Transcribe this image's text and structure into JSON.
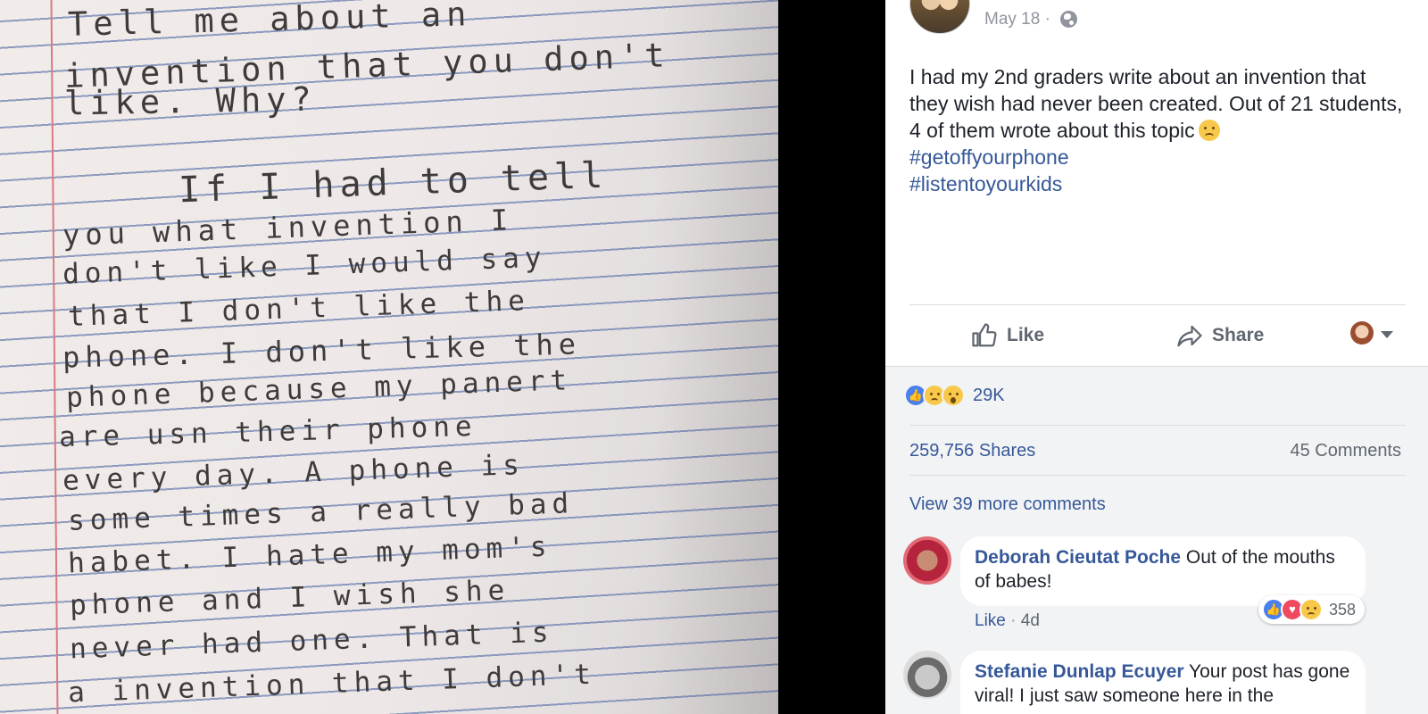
{
  "photo": {
    "handwriting": [
      "Tell   me   about   an",
      "invention  that  you  don't",
      "like. Why?",
      "If  I    had  to  tell",
      "you   what   invention  I",
      "don't   like     I   would   say",
      "that   I   don't    like   the",
      "phone. I   don't   like   the",
      "phone   because   my   panert",
      "are   usn   their   phone",
      "every  day.  A   phone   is",
      "some times   a   really   bad",
      "habet. I   hate   my   mom's",
      "phone   and   I   wish   she",
      "never   had   one.  That   is",
      "a  invention   that   I    don't"
    ]
  },
  "post": {
    "date": "May 18 ·",
    "text": "I had my 2nd graders write about an invention that they wish had never been created. Out of 21 students, 4 of them wrote about this topic",
    "hashtags": [
      "#getoffyourphone",
      "#listentoyourkids"
    ]
  },
  "actions": {
    "like_label": "Like",
    "share_label": "Share"
  },
  "stats": {
    "reaction_count": "29K",
    "shares": "259,756 Shares",
    "comments": "45 Comments",
    "view_more": "View 39 more comments"
  },
  "comments": [
    {
      "name": "Deborah Cieutat Poche",
      "text": "Out of the mouths of babes!",
      "like_label": "Like",
      "age": "4d",
      "reaction_count": "358"
    },
    {
      "name": "Stefanie Dunlap Ecuyer",
      "text": "Your post has gone viral! I just saw someone here in the"
    }
  ],
  "colors": {
    "link": "#365899",
    "text": "#1d2129",
    "muted": "#606770",
    "like_blue": "#4a7ff0",
    "haha_yellow": "#f7c84a",
    "love_red": "#f0485e"
  },
  "icons": [
    "globe-icon",
    "like-icon",
    "share-icon",
    "caret-down-icon",
    "sad-emoji"
  ]
}
